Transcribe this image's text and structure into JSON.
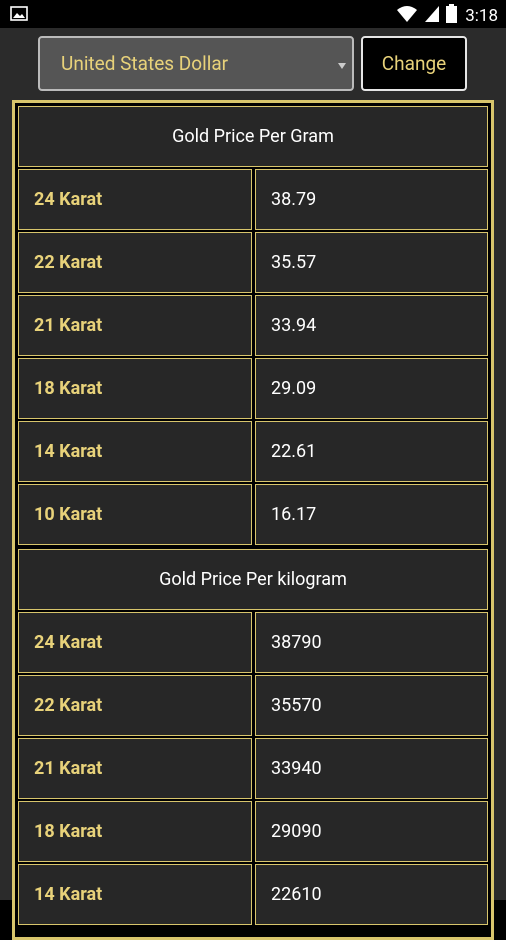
{
  "status": {
    "time": "3:18"
  },
  "currency": {
    "selected": "United States Dollar"
  },
  "actions": {
    "change_label": "Change"
  },
  "sections": [
    {
      "title": "Gold Price Per Gram",
      "rows": [
        {
          "karat": "24 Karat",
          "price": "38.79"
        },
        {
          "karat": "22 Karat",
          "price": "35.57"
        },
        {
          "karat": "21 Karat",
          "price": "33.94"
        },
        {
          "karat": "18 Karat",
          "price": "29.09"
        },
        {
          "karat": "14 Karat",
          "price": "22.61"
        },
        {
          "karat": "10 Karat",
          "price": "16.17"
        }
      ]
    },
    {
      "title": "Gold Price Per kilogram",
      "rows": [
        {
          "karat": "24 Karat",
          "price": "38790"
        },
        {
          "karat": "22 Karat",
          "price": "35570"
        },
        {
          "karat": "21 Karat",
          "price": "33940"
        },
        {
          "karat": "18 Karat",
          "price": "29090"
        },
        {
          "karat": "14 Karat",
          "price": "22610"
        }
      ]
    }
  ]
}
